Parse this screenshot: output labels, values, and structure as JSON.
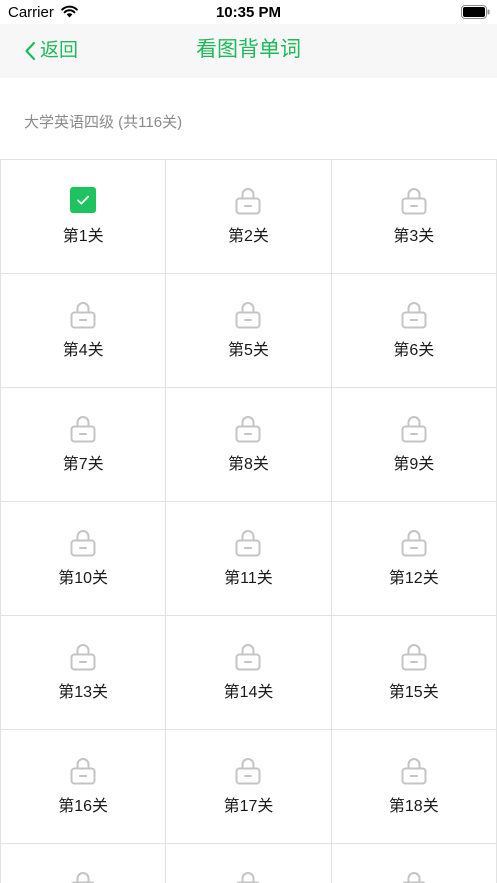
{
  "status_bar": {
    "carrier": "Carrier",
    "time": "10:35 PM",
    "wifi_icon": "wifi-icon",
    "battery_icon": "battery-icon"
  },
  "nav": {
    "back_icon": "chevron-left-icon",
    "back_label": "返回",
    "title": "看图背单词"
  },
  "level_set": {
    "title": "大学英语四级 (共116关)"
  },
  "levels": [
    {
      "label": "第1关",
      "status": "completed",
      "icon": "check-icon"
    },
    {
      "label": "第2关",
      "status": "locked",
      "icon": "lock-icon"
    },
    {
      "label": "第3关",
      "status": "locked",
      "icon": "lock-icon"
    },
    {
      "label": "第4关",
      "status": "locked",
      "icon": "lock-icon"
    },
    {
      "label": "第5关",
      "status": "locked",
      "icon": "lock-icon"
    },
    {
      "label": "第6关",
      "status": "locked",
      "icon": "lock-icon"
    },
    {
      "label": "第7关",
      "status": "locked",
      "icon": "lock-icon"
    },
    {
      "label": "第8关",
      "status": "locked",
      "icon": "lock-icon"
    },
    {
      "label": "第9关",
      "status": "locked",
      "icon": "lock-icon"
    },
    {
      "label": "第10关",
      "status": "locked",
      "icon": "lock-icon"
    },
    {
      "label": "第11关",
      "status": "locked",
      "icon": "lock-icon"
    },
    {
      "label": "第12关",
      "status": "locked",
      "icon": "lock-icon"
    },
    {
      "label": "第13关",
      "status": "locked",
      "icon": "lock-icon"
    },
    {
      "label": "第14关",
      "status": "locked",
      "icon": "lock-icon"
    },
    {
      "label": "第15关",
      "status": "locked",
      "icon": "lock-icon"
    },
    {
      "label": "第16关",
      "status": "locked",
      "icon": "lock-icon"
    },
    {
      "label": "第17关",
      "status": "locked",
      "icon": "lock-icon"
    },
    {
      "label": "第18关",
      "status": "locked",
      "icon": "lock-icon"
    }
  ],
  "partial_row": [
    {
      "status": "locked",
      "icon": "lock-icon"
    },
    {
      "status": "locked",
      "icon": "lock-icon"
    },
    {
      "status": "locked",
      "icon": "lock-icon"
    }
  ],
  "colors": {
    "accent": "#1fb95b",
    "completed": "#1ec25f",
    "locked": "#c4c4c4",
    "grid_line": "#e2e2e2",
    "nav_background": "#f7f7f7",
    "subtitle_text": "#8a8a8a"
  }
}
